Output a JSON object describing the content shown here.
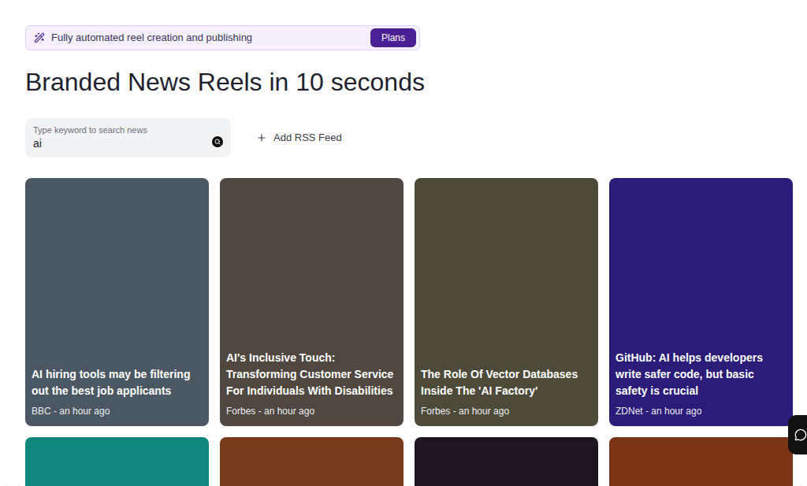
{
  "banner": {
    "text": "Fully automated reel creation and publishing",
    "button": "Plans"
  },
  "heading": "Branded News Reels in 10 seconds",
  "search": {
    "label": "Type keyword to search news",
    "value": "ai"
  },
  "add_feed": {
    "label": "Add RSS Feed"
  },
  "cards": [
    {
      "title": "AI hiring tools may be filtering out the best job applicants",
      "source": "BBC - an hour ago",
      "color": "#4b5863"
    },
    {
      "title": "AI's Inclusive Touch: Transforming Customer Service For Individuals With Disabilities",
      "source": "Forbes - an hour ago",
      "color": "#4f4740"
    },
    {
      "title": "The Role Of Vector Databases Inside The 'AI Factory'",
      "source": "Forbes - an hour ago",
      "color": "#4e4a3a"
    },
    {
      "title": "GitHub: AI helps developers write safer code, but basic safety is crucial",
      "source": "ZDNet - an hour ago",
      "color": "#2a1c78"
    }
  ],
  "more_cards": [
    {
      "color": "#0f877d"
    },
    {
      "color": "#7a3a1e"
    },
    {
      "color": "#1e1520"
    },
    {
      "color": "#7a3416"
    }
  ]
}
